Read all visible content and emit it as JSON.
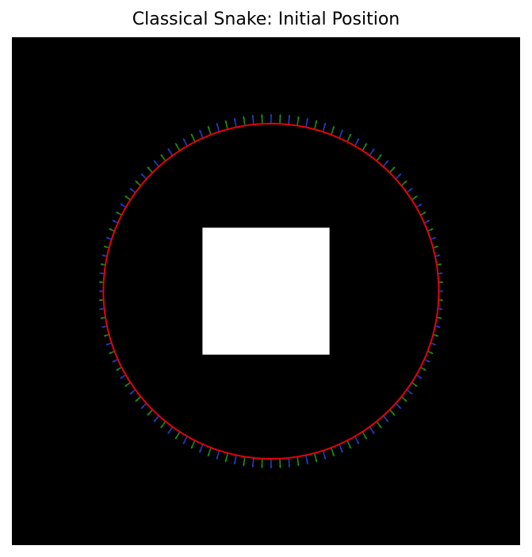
{
  "chart_data": {
    "type": "scatter",
    "title": "Classical Snake: Initial Position",
    "xlabel": "",
    "ylabel": "",
    "image_extent": [
      0,
      100
    ],
    "background_color": "#000000",
    "square": {
      "x": [
        37.5,
        62.5
      ],
      "y": [
        37.5,
        62.5
      ],
      "color": "#ffffff"
    },
    "snake_contour": {
      "center": [
        51,
        50
      ],
      "rx": 33,
      "ry": 33,
      "n_points": 200,
      "color": "#e8000b"
    },
    "force_arrows": {
      "count": 120,
      "colors": [
        "#1f3fbf",
        "#1a8c1a"
      ],
      "shape": "vertical stretch ratio ~0.1 of radius (top/bottom), horizontal ~0.05"
    },
    "axes_visible": false
  }
}
